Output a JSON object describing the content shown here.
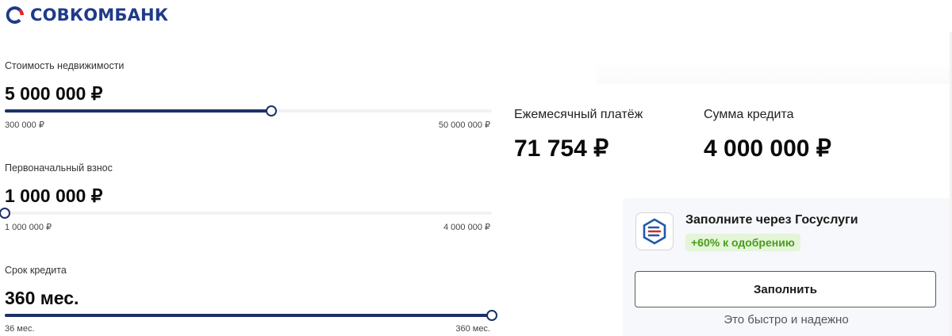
{
  "brand": {
    "name": "СОВКОМБАНК",
    "accent": "#1f3a8a",
    "logo_red": "#e3241b"
  },
  "calculator": {
    "property": {
      "label": "Стоимость недвижимости",
      "value": "5 000 000 ₽",
      "min": "300 000 ₽",
      "max": "50 000 000 ₽",
      "fraction": 0.548
    },
    "down_payment": {
      "label": "Первоначальный взнос",
      "value": "1 000 000 ₽",
      "min": "1 000 000 ₽",
      "max": "4 000 000 ₽",
      "fraction": 0.0
    },
    "term": {
      "label": "Срок кредита",
      "value": "360 мес.",
      "min": "36 мес.",
      "max": "360 мес.",
      "fraction": 1.0
    },
    "slider_color": "#1b3168"
  },
  "results": {
    "monthly_label": "Ежемесячный платёж",
    "monthly_value": "71 754 ₽",
    "loan_label": "Сумма кредита",
    "loan_value": "4 000 000 ₽"
  },
  "gosuslugi": {
    "title": "Заполните через Госуслуги",
    "badge": "+60% к одобрению",
    "button": "Заполнить",
    "note": "Это быстро и надежно",
    "icon": "gosuslugi-logo-icon"
  }
}
